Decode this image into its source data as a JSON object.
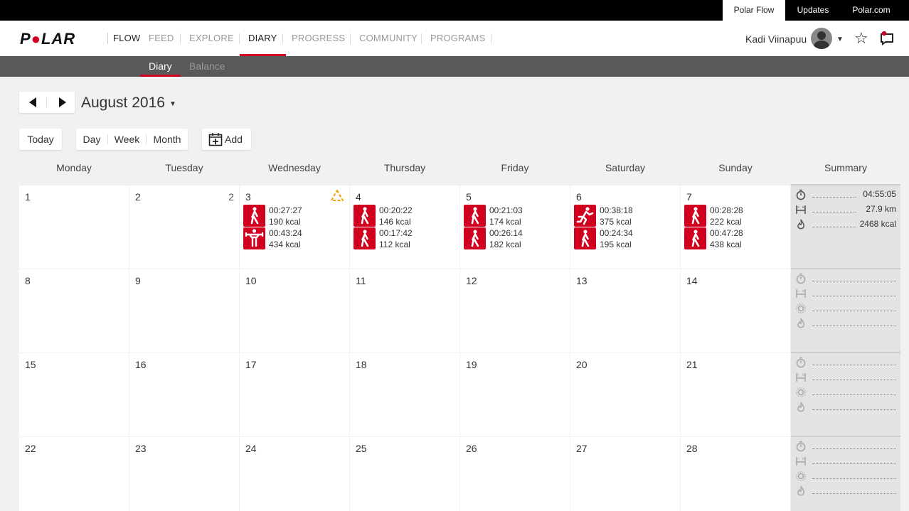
{
  "topbar": {
    "polar_flow": "Polar Flow",
    "updates": "Updates",
    "polar_com": "Polar.com"
  },
  "nav": {
    "logo": "POLAR",
    "flow": "FLOW",
    "items": [
      "FEED",
      "EXPLORE",
      "DIARY",
      "PROGRESS",
      "COMMUNITY",
      "PROGRAMS"
    ],
    "active": "DIARY",
    "username": "Kadi Viinapuu"
  },
  "subnav": {
    "diary": "Diary",
    "balance": "Balance"
  },
  "toolbar": {
    "month_title": "August 2016",
    "today": "Today",
    "day": "Day",
    "week": "Week",
    "month": "Month",
    "add": "Add"
  },
  "calendar": {
    "days_of_week": [
      "Monday",
      "Tuesday",
      "Wednesday",
      "Thursday",
      "Friday",
      "Saturday",
      "Sunday"
    ],
    "summary_header": "Summary",
    "weeks": [
      {
        "days": [
          {
            "num": "1",
            "activities": []
          },
          {
            "num": "2",
            "extra": "2",
            "activities": []
          },
          {
            "num": "3",
            "warning": true,
            "activities": [
              {
                "icon": "walking-icon",
                "time": "00:27:27",
                "kcal": "190 kcal"
              },
              {
                "icon": "strength-icon",
                "time": "00:43:24",
                "kcal": "434 kcal"
              }
            ]
          },
          {
            "num": "4",
            "activities": [
              {
                "icon": "walking-icon",
                "time": "00:20:22",
                "kcal": "146 kcal"
              },
              {
                "icon": "walking-icon",
                "time": "00:17:42",
                "kcal": "112 kcal"
              }
            ]
          },
          {
            "num": "5",
            "activities": [
              {
                "icon": "walking-icon",
                "time": "00:21:03",
                "kcal": "174 kcal"
              },
              {
                "icon": "walking-icon",
                "time": "00:26:14",
                "kcal": "182 kcal"
              }
            ]
          },
          {
            "num": "6",
            "activities": [
              {
                "icon": "running-icon",
                "time": "00:38:18",
                "kcal": "375 kcal"
              },
              {
                "icon": "walking-icon",
                "time": "00:24:34",
                "kcal": "195 kcal"
              }
            ]
          },
          {
            "num": "7",
            "activities": [
              {
                "icon": "walking-icon",
                "time": "00:28:28",
                "kcal": "222 kcal"
              },
              {
                "icon": "walking-icon",
                "time": "00:47:28",
                "kcal": "438 kcal"
              }
            ]
          }
        ],
        "summary": {
          "duration": "04:55:05",
          "distance": "27.9 km",
          "calories": "2468 kcal"
        }
      },
      {
        "days": [
          {
            "num": "8"
          },
          {
            "num": "9"
          },
          {
            "num": "10"
          },
          {
            "num": "11"
          },
          {
            "num": "12"
          },
          {
            "num": "13"
          },
          {
            "num": "14"
          }
        ]
      },
      {
        "days": [
          {
            "num": "15"
          },
          {
            "num": "16"
          },
          {
            "num": "17"
          },
          {
            "num": "18"
          },
          {
            "num": "19"
          },
          {
            "num": "20"
          },
          {
            "num": "21"
          }
        ]
      },
      {
        "days": [
          {
            "num": "22"
          },
          {
            "num": "23"
          },
          {
            "num": "24"
          },
          {
            "num": "25"
          },
          {
            "num": "26"
          },
          {
            "num": "27"
          },
          {
            "num": "28"
          }
        ]
      }
    ]
  },
  "colors": {
    "accent": "#d1001f",
    "warning": "#f5a000",
    "subnav_bg": "#58595b",
    "summary_bg": "#e3e3e3"
  }
}
